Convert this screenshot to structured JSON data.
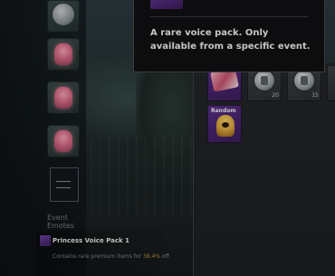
{
  "tooltip": {
    "description": "A rare voice pack. Only available from a specific event."
  },
  "inventory": {
    "slots": [
      {
        "kind": "rare-item",
        "count": ""
      },
      {
        "kind": "ammo",
        "count": "20"
      },
      {
        "kind": "ammo",
        "count": "15"
      },
      {
        "kind": "random-voice-pack",
        "label": "Random"
      }
    ]
  },
  "sidebar": {
    "event_label": "Event Emotes"
  },
  "bottom_panel": {
    "title": "Princess Voice Pack 1",
    "desc_prefix": "Contains rare premium items for",
    "desc_highlight": "38.4%",
    "desc_suffix": "off"
  },
  "colors": {
    "rarity_purple": "#5a2f88",
    "panel_bg": "#24262a",
    "tooltip_bg": "#101012"
  }
}
